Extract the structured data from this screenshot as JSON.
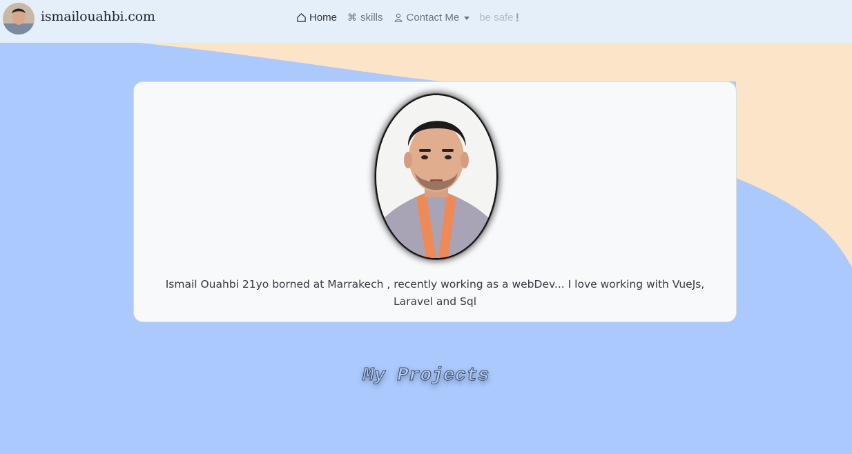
{
  "navbar": {
    "brand_name": "ismailouahbi.com",
    "avatar_icon": "user-avatar-photo",
    "links": [
      {
        "label": "Home",
        "icon": "house-icon",
        "state": "active"
      },
      {
        "label": "skills",
        "icon": "command-icon",
        "state": "normal"
      },
      {
        "label": "Contact Me",
        "icon": "person-icon",
        "state": "dropdown"
      },
      {
        "label": "be safe",
        "icon": "exclamation-icon",
        "state": "disabled"
      }
    ],
    "exclamation": "!"
  },
  "profile": {
    "photo_icon": "profile-portrait",
    "bio": "Ismail Ouahbi 21yo borned at Marrakech , recently working as a webDev... I love working with VueJs, Laravel and Sql"
  },
  "projects": {
    "title": "My Projects"
  },
  "colors": {
    "background_blue": "#abc9fd",
    "background_peach": "#fbe4c7",
    "navbar": "#e4eff9",
    "card": "#f8f9fb"
  }
}
